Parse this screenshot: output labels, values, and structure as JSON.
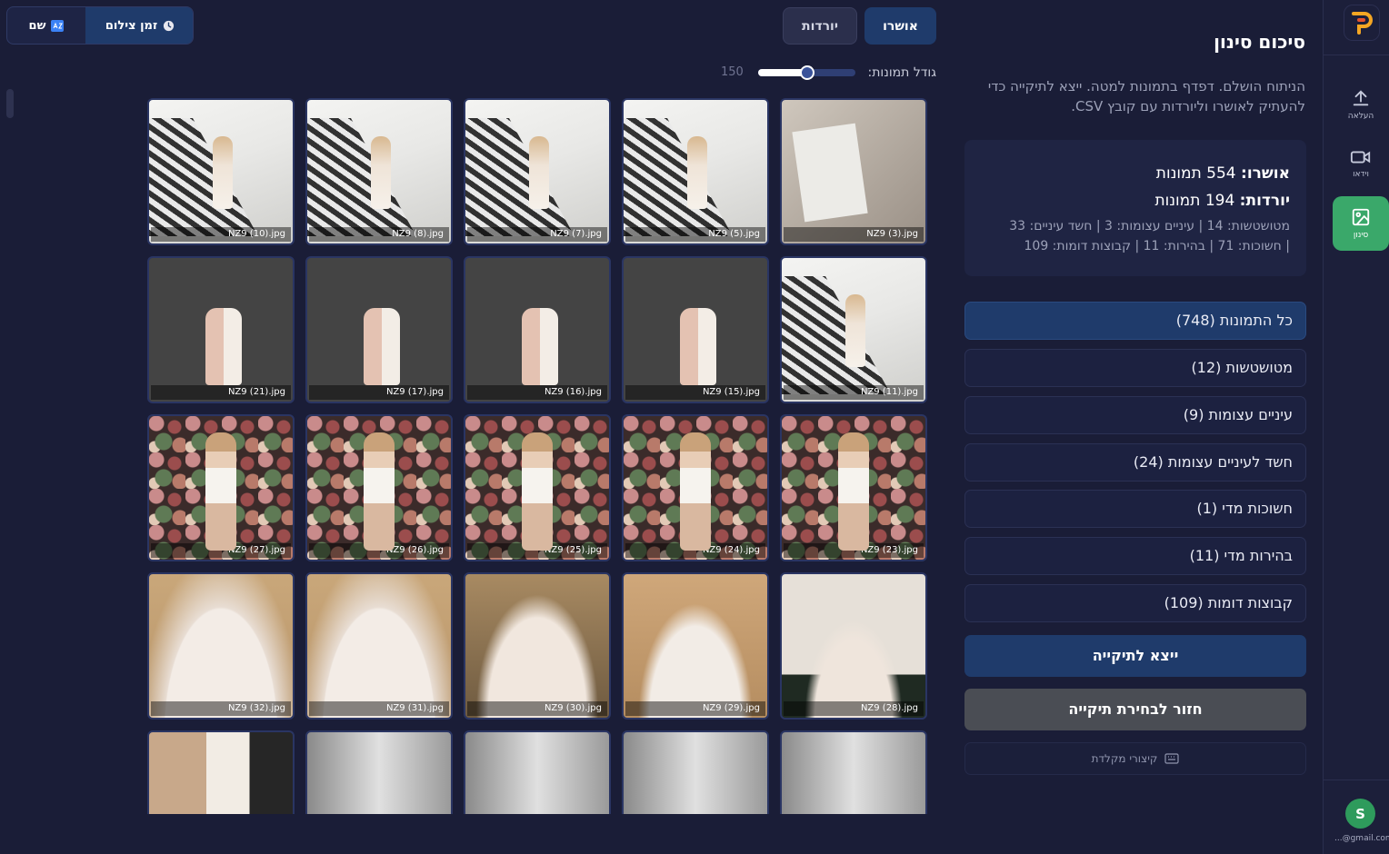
{
  "rail": {
    "items": [
      {
        "label": "העלאה",
        "icon": "upload-icon"
      },
      {
        "label": "וידאו",
        "icon": "video-icon"
      },
      {
        "label": "סינון",
        "icon": "image-icon",
        "active": true
      }
    ],
    "avatar_letter": "S",
    "email": "...@gmail.com"
  },
  "panel": {
    "title": "סיכום סינון",
    "description": "הניתוח הושלם. דפדף בתמונות למטה. ייצא לתיקייה כדי להעתיק לאושרו וליורדות עם קובץ CSV.",
    "approved_label": "אושרו:",
    "approved_value": "554 תמונות",
    "rejected_label": "יורדות:",
    "rejected_value": "194 תמונות",
    "breakdown_1": "מטושטשות: 14 | עיניים עצומות: 3 | חשד עיניים: 33",
    "breakdown_2": "| חשוכות: 71 | בהירות: 11 | קבוצות דומות: 109",
    "filters": [
      "כל התמונות (748)",
      "מטושטשות (12)",
      "עיניים עצומות (9)",
      "חשד לעיניים עצומות (24)",
      "חשוכות מדי (1)",
      "בהירות מדי (11)",
      "קבוצות דומות (109)"
    ],
    "export_label": "ייצא לתיקייה",
    "back_label": "חזור לבחירת תיקייה",
    "shortcuts_label": "קיצורי מקלדת"
  },
  "toolbar": {
    "approved_tab": "אושרו",
    "downloads_tab": "יורדות",
    "sort_time": "זמן צילום",
    "sort_name": "שם",
    "size_label": "גודל תמונות:",
    "size_value": "150",
    "size_fraction": 0.5
  },
  "photos": [
    {
      "name": "NZ9 (3).jpg",
      "kind": "invite"
    },
    {
      "name": "NZ9 (5).jpg",
      "kind": "stairs"
    },
    {
      "name": "NZ9 (7).jpg",
      "kind": "stairs"
    },
    {
      "name": "NZ9 (8).jpg",
      "kind": "stairs"
    },
    {
      "name": "NZ9 (10).jpg",
      "kind": "stairs"
    },
    {
      "name": "NZ9 (11).jpg",
      "kind": "stairs"
    },
    {
      "name": "NZ9 (15).jpg",
      "kind": "duo"
    },
    {
      "name": "NZ9 (16).jpg",
      "kind": "duo"
    },
    {
      "name": "NZ9 (17).jpg",
      "kind": "duo"
    },
    {
      "name": "NZ9 (21).jpg",
      "kind": "duo"
    },
    {
      "name": "NZ9 (23).jpg",
      "kind": "floral"
    },
    {
      "name": "NZ9 (24).jpg",
      "kind": "floral"
    },
    {
      "name": "NZ9 (25).jpg",
      "kind": "floral"
    },
    {
      "name": "NZ9 (26).jpg",
      "kind": "floral"
    },
    {
      "name": "NZ9 (27).jpg",
      "kind": "floral"
    },
    {
      "name": "NZ9 (28).jpg",
      "kind": "stand"
    },
    {
      "name": "NZ9 (29).jpg",
      "kind": "hanger"
    },
    {
      "name": "NZ9 (30).jpg",
      "kind": "gown2"
    },
    {
      "name": "NZ9 (31).jpg",
      "kind": "gown"
    },
    {
      "name": "NZ9 (32).jpg",
      "kind": "gown"
    },
    {
      "name": "",
      "kind": "bw"
    },
    {
      "name": "",
      "kind": "bw"
    },
    {
      "name": "",
      "kind": "bw"
    },
    {
      "name": "",
      "kind": "bw"
    },
    {
      "name": "",
      "kind": "corridor"
    }
  ],
  "colors": {
    "background": "#1a1d37",
    "accent_blue": "#1f3b6b",
    "active_green": "#3aa86a",
    "logo_orange": "#f5a623"
  }
}
